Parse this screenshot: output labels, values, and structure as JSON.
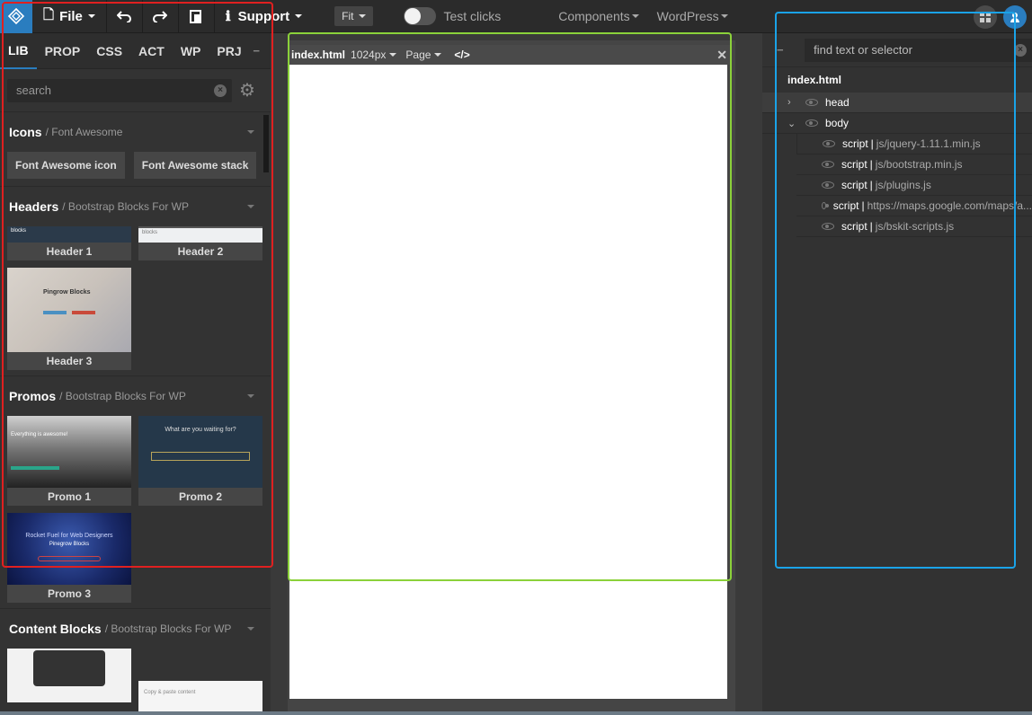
{
  "topbar": {
    "file_label": "File",
    "support_label": "Support",
    "fit_label": "Fit",
    "test_clicks_label": "Test clicks",
    "components_label": "Components",
    "wordpress_label": "WordPress"
  },
  "left": {
    "tabs": [
      "LIB",
      "PROP",
      "CSS",
      "ACT",
      "WP",
      "PRJ"
    ],
    "search_placeholder": "search",
    "sections": {
      "icons": {
        "title": "Icons",
        "sub": "/ Font Awesome",
        "buttons": [
          "Font Awesome icon",
          "Font Awesome stack"
        ]
      },
      "headers": {
        "title": "Headers",
        "sub": "/ Bootstrap Blocks For WP",
        "items": [
          "Header 1",
          "Header 2",
          "Header 3"
        ],
        "thumb_text": [
          "blocks",
          "blocks",
          "Pingrow Blocks"
        ]
      },
      "promos": {
        "title": "Promos",
        "sub": "/ Bootstrap Blocks For WP",
        "items": [
          "Promo 1",
          "Promo 2",
          "Promo 3"
        ],
        "thumb_text": [
          "Everything is awesome!",
          "What are you waiting for?",
          "Rocket Fuel for Web Designers",
          "Pinegrow Blocks"
        ]
      },
      "content": {
        "title": "Content Blocks",
        "sub": "/ Bootstrap Blocks For WP",
        "thumb_text": "Copy & paste content"
      }
    }
  },
  "canvas": {
    "file_name": "index.html",
    "width_label": "1024px",
    "page_label": "Page",
    "code_label": "</>"
  },
  "right": {
    "search_placeholder": "find text or selector",
    "root": "index.html",
    "nodes": [
      {
        "tag": "head"
      },
      {
        "tag": "body"
      },
      {
        "tag": "script",
        "attr": "js/jquery-1.11.1.min.js"
      },
      {
        "tag": "script",
        "attr": "js/bootstrap.min.js"
      },
      {
        "tag": "script",
        "attr": "js/plugins.js"
      },
      {
        "tag": "script",
        "attr": "https://maps.google.com/maps/a..."
      },
      {
        "tag": "script",
        "attr": "js/bskit-scripts.js"
      }
    ]
  },
  "colors": {
    "accent": "#2a7dbf",
    "highlight_red": "#e02020",
    "highlight_green": "#8bd13a",
    "highlight_blue": "#1aa3e8"
  }
}
